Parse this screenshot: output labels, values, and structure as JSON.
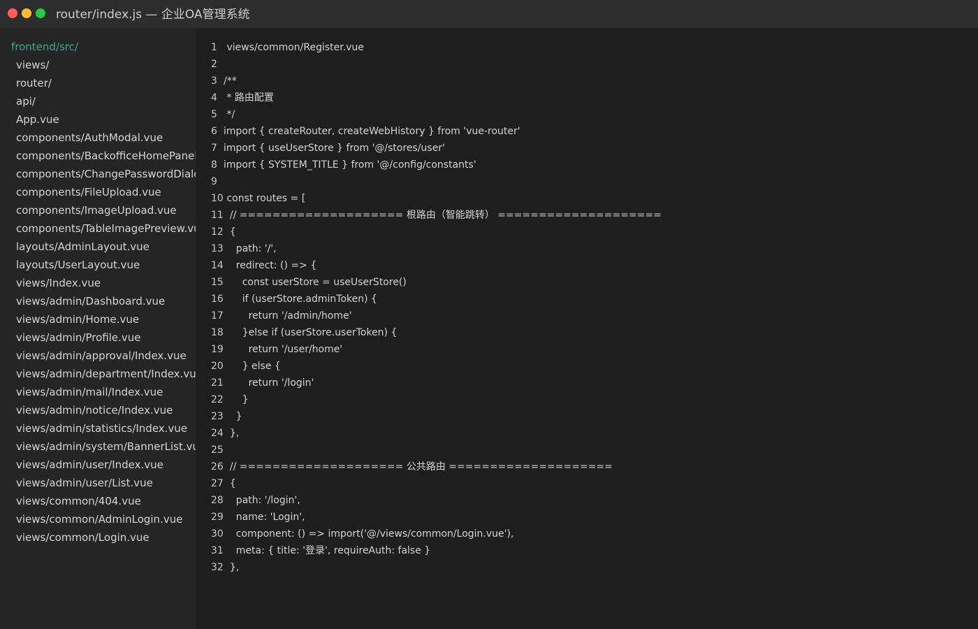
{
  "window": {
    "title": "router/index.js — 企业OA管理系统",
    "traffic_lights": {
      "close": "#ff5f57",
      "minimize": "#febc2e",
      "maximize": "#28c840"
    }
  },
  "sidebar": {
    "root": "frontend/src/",
    "root_color": "#3aa891",
    "items": [
      "views/",
      "router/",
      "api/",
      "App.vue",
      "components/AuthModal.vue",
      "components/BackofficeHomePanel.vue",
      "components/ChangePasswordDialog.vue",
      "components/FileUpload.vue",
      "components/ImageUpload.vue",
      "components/TableImagePreview.vue",
      "layouts/AdminLayout.vue",
      "layouts/UserLayout.vue",
      "views/Index.vue",
      "views/admin/Dashboard.vue",
      "views/admin/Home.vue",
      "views/admin/Profile.vue",
      "views/admin/approval/Index.vue",
      "views/admin/department/Index.vue",
      "views/admin/mail/Index.vue",
      "views/admin/notice/Index.vue",
      "views/admin/statistics/Index.vue",
      "views/admin/system/BannerList.vue",
      "views/admin/user/Index.vue",
      "views/admin/user/List.vue",
      "views/common/404.vue",
      "views/common/AdminLogin.vue",
      "views/common/Login.vue"
    ]
  },
  "editor": {
    "lines": [
      {
        "n": "1",
        "text": " views/common/Register.vue"
      },
      {
        "n": "2",
        "text": ""
      },
      {
        "n": "3",
        "text": "/**"
      },
      {
        "n": "4",
        "text": " * 路由配置"
      },
      {
        "n": "5",
        "text": " */"
      },
      {
        "n": "6",
        "text": "import { createRouter, createWebHistory } from 'vue-router'"
      },
      {
        "n": "7",
        "text": "import { useUserStore } from '@/stores/user'"
      },
      {
        "n": "8",
        "text": "import { SYSTEM_TITLE } from '@/config/constants'"
      },
      {
        "n": "9",
        "text": ""
      },
      {
        "n": "10",
        "text": " const routes = ["
      },
      {
        "n": "11",
        "text": "  // ==================== 根路由（智能跳转） ===================="
      },
      {
        "n": "12",
        "text": "  {"
      },
      {
        "n": "13",
        "text": "    path: '/',"
      },
      {
        "n": "14",
        "text": "    redirect: () => {"
      },
      {
        "n": "15",
        "text": "      const userStore = useUserStore()"
      },
      {
        "n": "16",
        "text": "      if (userStore.adminToken) {"
      },
      {
        "n": "17",
        "text": "        return '/admin/home'"
      },
      {
        "n": "18",
        "text": "      }else if (userStore.userToken) {"
      },
      {
        "n": "19",
        "text": "        return '/user/home'"
      },
      {
        "n": "20",
        "text": "      } else {"
      },
      {
        "n": "21",
        "text": "        return '/login'"
      },
      {
        "n": "22",
        "text": "      }"
      },
      {
        "n": "23",
        "text": "    }"
      },
      {
        "n": "24",
        "text": "  },"
      },
      {
        "n": "25",
        "text": ""
      },
      {
        "n": "26",
        "text": "  // ==================== 公共路由 ===================="
      },
      {
        "n": "27",
        "text": "  {"
      },
      {
        "n": "28",
        "text": "    path: '/login',"
      },
      {
        "n": "29",
        "text": "    name: 'Login',"
      },
      {
        "n": "30",
        "text": "    component: () => import('@/views/common/Login.vue'),"
      },
      {
        "n": "31",
        "text": "    meta: { title: '登录', requireAuth: false }"
      },
      {
        "n": "32",
        "text": "  },"
      }
    ]
  }
}
